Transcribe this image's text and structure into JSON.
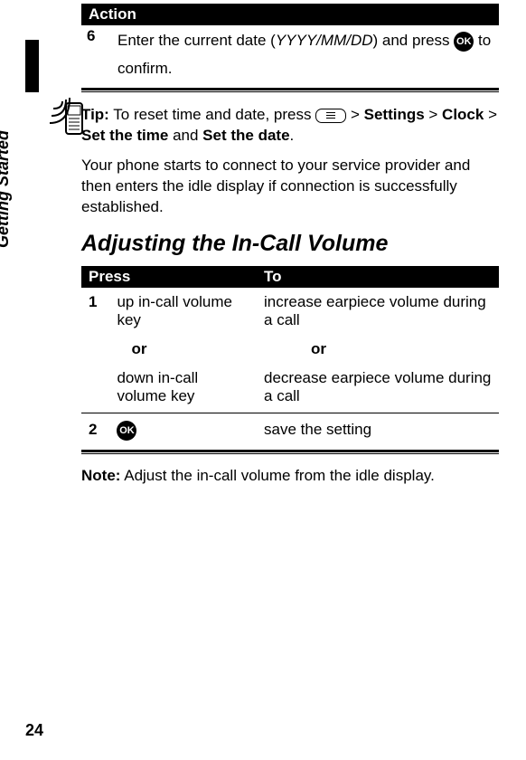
{
  "sidebar": {
    "section": "Getting Started"
  },
  "action": {
    "header": "Action",
    "step_num": "6",
    "step_text_before": "Enter the current date (",
    "date_fmt": "YYYY/MM/DD",
    "step_text_mid": ") and press ",
    "ok": "OK",
    "step_text_after": " to confirm."
  },
  "tip": {
    "label": "Tip:",
    "text1": " To reset time and date, press ",
    "gt": " > ",
    "settings": "Settings",
    "clock": "Clock",
    "set_time": "Set the time",
    "and": " and ",
    "set_date": "Set the date",
    "period": "."
  },
  "body": {
    "para": "Your phone starts to connect to your service provider and then enters the idle display if connection is successfully established."
  },
  "heading": "Adjusting the In-Call Volume",
  "vol": {
    "col_press": "Press",
    "col_to": "To",
    "r1_num": "1",
    "r1_press": "up in-call volume key",
    "r1_to": "increase earpiece volume during a call",
    "or": "or",
    "r1b_press": "down in-call volume key",
    "r1b_to": "decrease earpiece volume during a call",
    "r2_num": "2",
    "r2_ok": "OK",
    "r2_to": "save the setting"
  },
  "note": {
    "label": "Note:",
    "text": " Adjust the in-call volume from the idle display."
  },
  "page_number": "24"
}
